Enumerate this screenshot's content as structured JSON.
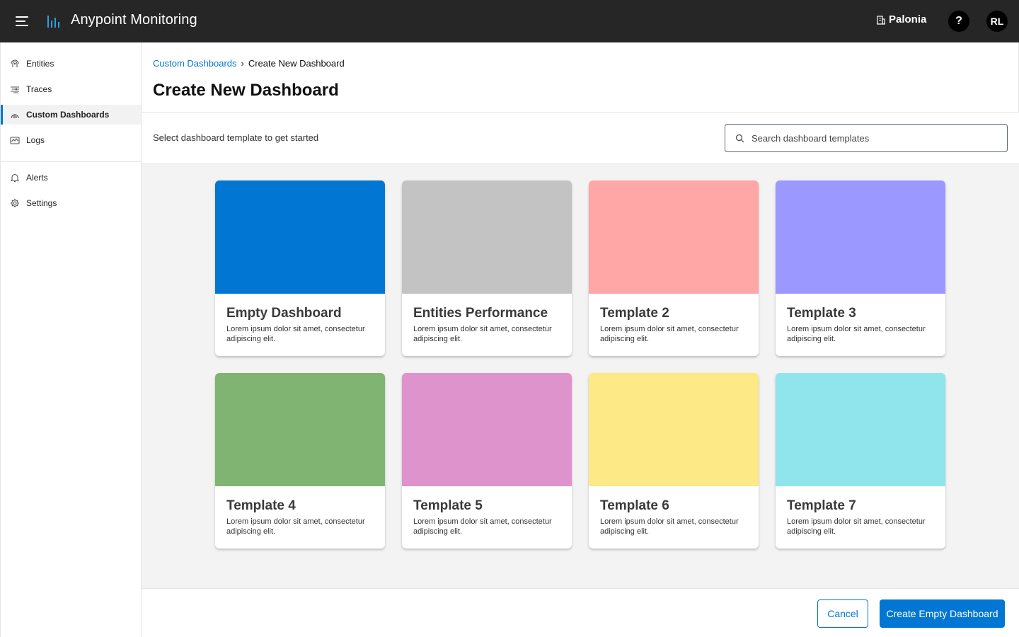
{
  "app": {
    "title": "Anypoint Monitoring",
    "logo_icon": "bar-chart-icon"
  },
  "header": {
    "org_name": "Palonia",
    "org_icon": "building-icon",
    "help_label": "?",
    "user_initials": "RL"
  },
  "sidebar": {
    "items": [
      {
        "label": "Entities",
        "icon": "entities-icon",
        "active": false
      },
      {
        "label": "Traces",
        "icon": "traces-icon",
        "active": false
      },
      {
        "label": "Custom Dashboards",
        "icon": "dashboard-icon",
        "active": true
      },
      {
        "label": "Logs",
        "icon": "logs-icon",
        "active": false
      },
      {
        "label": "Alerts",
        "icon": "bell-icon",
        "active": false
      },
      {
        "label": "Settings",
        "icon": "gear-icon",
        "active": false
      }
    ]
  },
  "breadcrumb": {
    "parent": "Custom Dashboards",
    "separator": "›",
    "current": "Create New Dashboard"
  },
  "page": {
    "title": "Create New Dashboard",
    "subtitle": "Select dashboard template to get started",
    "search_placeholder": "Search dashboard templates"
  },
  "templates": [
    {
      "title": "Empty Dashboard",
      "description": "Lorem ipsum dolor sit amet, consectetur adipiscing elit.",
      "color": "#0176d3"
    },
    {
      "title": "Entities Performance",
      "description": "Lorem ipsum dolor sit amet, consectetur adipiscing elit.",
      "color": "#c3c3c3"
    },
    {
      "title": "Template 2",
      "description": "Lorem ipsum dolor sit amet, consectetur adipiscing elit.",
      "color": "#ffa6a6"
    },
    {
      "title": "Template 3",
      "description": "Lorem ipsum dolor sit amet, consectetur adipiscing elit.",
      "color": "#9b99ff"
    },
    {
      "title": "Template 4",
      "description": "Lorem ipsum dolor sit amet, consectetur adipiscing elit.",
      "color": "#7fb472"
    },
    {
      "title": "Template 5",
      "description": "Lorem ipsum dolor sit amet, consectetur adipiscing elit.",
      "color": "#df93cc"
    },
    {
      "title": "Template 6",
      "description": "Lorem ipsum dolor sit amet, consectetur adipiscing elit.",
      "color": "#fde986"
    },
    {
      "title": "Template 7",
      "description": "Lorem ipsum dolor sit amet, consectetur adipiscing elit.",
      "color": "#8fe5eb"
    }
  ],
  "footer": {
    "cancel_label": "Cancel",
    "primary_label": "Create Empty Dashboard"
  },
  "colors": {
    "accent": "#0176d3",
    "topbar": "#262626"
  }
}
